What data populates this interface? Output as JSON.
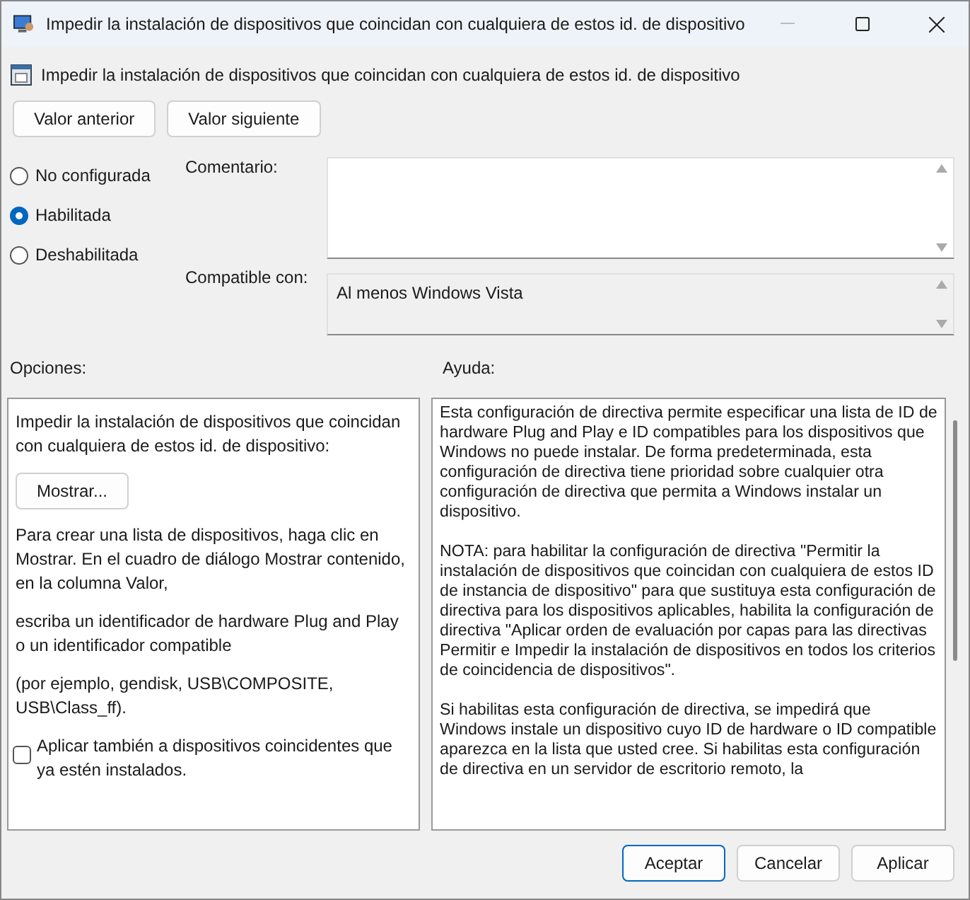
{
  "window": {
    "title": "Impedir la instalación de dispositivos que coincidan con cualquiera de estos id. de dispositivo"
  },
  "header": {
    "title": "Impedir la instalación de dispositivos que coincidan con cualquiera de estos id. de dispositivo"
  },
  "nav_buttons": [
    "Valor anterior",
    "Valor siguiente"
  ],
  "states": [
    {
      "label": "No configurada",
      "selected": false
    },
    {
      "label": "Habilitada",
      "selected": true
    },
    {
      "label": "Deshabilitada",
      "selected": false
    }
  ],
  "comment": {
    "label": "Comentario:"
  },
  "supported": {
    "label": "Compatible con:",
    "value": "Al menos Windows Vista"
  },
  "options": {
    "label": "Opciones:",
    "items": [
      {
        "kind": "text",
        "text": "Impedir la instalación de dispositivos que coincidan con cualquiera de estos id. de dispositivo:"
      },
      {
        "kind": "button",
        "text": "Mostrar..."
      },
      {
        "kind": "text",
        "text": "Para crear una lista de dispositivos, haga clic en Mostrar. En el cuadro de diálogo Mostrar contenido, en la columna Valor,"
      },
      {
        "kind": "text",
        "text": "escriba un identificador de hardware Plug and Play o un identificador compatible"
      },
      {
        "kind": "text",
        "text": "(por ejemplo, gendisk, USB\\COMPOSITE, USB\\Class_ff)."
      },
      {
        "kind": "checkbox",
        "text": "Aplicar también a dispositivos coincidentes que ya estén instalados.",
        "checked": false
      }
    ]
  },
  "help": {
    "label": "Ayuda:",
    "paragraphs": [
      "Esta configuración de directiva permite especificar una lista de ID de hardware Plug and Play e ID compatibles para los dispositivos que Windows no puede instalar. De forma predeterminada, esta configuración de directiva tiene prioridad sobre cualquier otra configuración de directiva que permita a Windows instalar un dispositivo.",
      "NOTA: para habilitar la configuración de directiva \"Permitir la instalación de dispositivos que coincidan con cualquiera de estos ID de instancia de dispositivo\" para que sustituya esta configuración de directiva para los dispositivos aplicables, habilita la configuración de directiva \"Aplicar orden de evaluación por capas para las directivas Permitir e Impedir la instalación de dispositivos en todos los criterios de coincidencia de dispositivos\".",
      "Si habilitas esta configuración de directiva, se impedirá que Windows instale un dispositivo cuyo ID de hardware o ID compatible aparezca en la lista que usted cree. Si habilitas esta configuración de directiva en un servidor de escritorio remoto, la"
    ]
  },
  "footer_buttons": [
    {
      "label": "Aceptar",
      "selected": true
    },
    {
      "label": "Cancelar",
      "selected": false
    },
    {
      "label": "Aplicar",
      "selected": false
    }
  ]
}
